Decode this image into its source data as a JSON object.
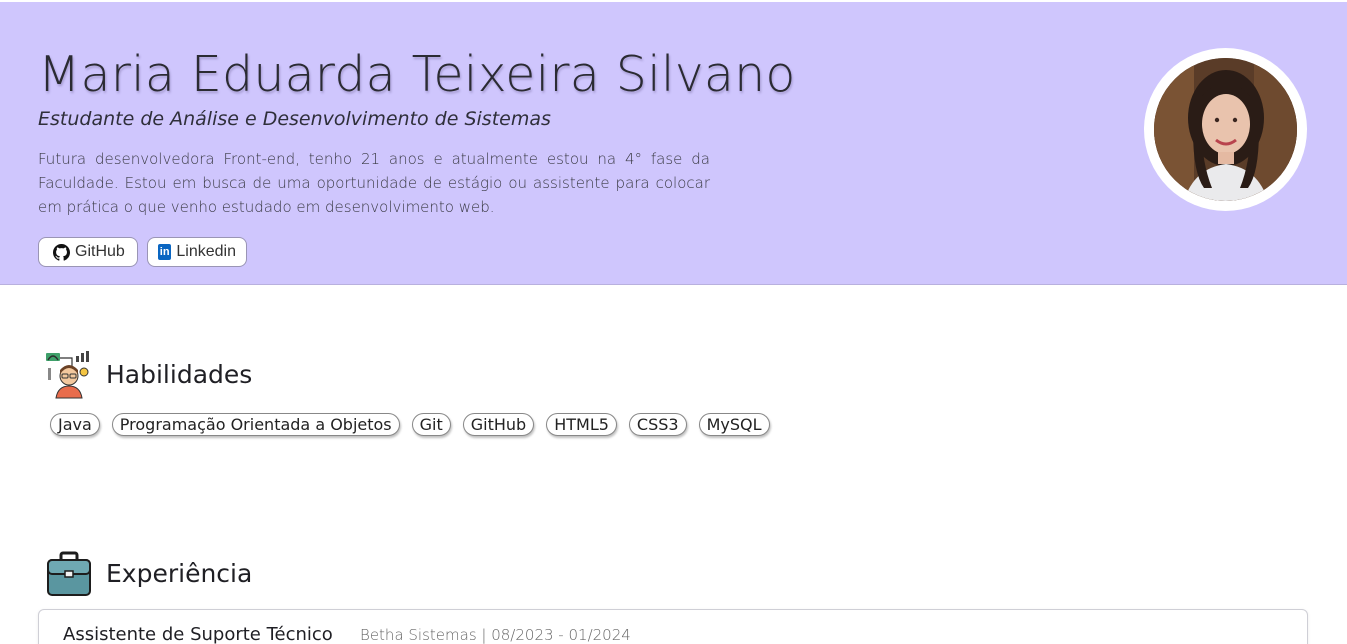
{
  "profile": {
    "name": "Maria Eduarda Teixeira Silvano",
    "subtitle": "Estudante de Análise e Desenvolvimento de Sistemas",
    "bio": "Futura desenvolvedora Front-end, tenho 21 anos e atualmente estou na 4° fase da Faculdade. Estou em busca de uma oportunidade de estágio ou assistente para colocar em prática o que venho estudado em desenvolvimento web."
  },
  "links": {
    "github_label": "GitHub",
    "linkedin_label": "Linkedin",
    "linkedin_icon_text": "in"
  },
  "skills": {
    "title": "Habilidades",
    "items": [
      "Java",
      "Programação Orientada a Objetos",
      "Git",
      "GitHub",
      "HTML5",
      "CSS3",
      "MySQL"
    ]
  },
  "experience": {
    "title": "Experiência",
    "items": [
      {
        "role": "Assistente de Suporte Técnico",
        "meta": "Betha Sistemas | 08/2023 - 01/2024"
      }
    ]
  },
  "colors": {
    "header_bg": "#cfc6fd",
    "linkedin_blue": "#0a66c2"
  },
  "icons": {
    "skills_icon": "developer-person-icon",
    "experience_icon": "briefcase-icon",
    "github_icon": "github-icon",
    "linkedin_icon": "linkedin-icon"
  }
}
